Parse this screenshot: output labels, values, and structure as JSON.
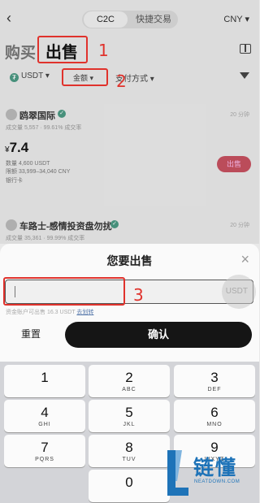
{
  "header": {
    "back_glyph": "‹",
    "tabs": [
      {
        "label": "C2C",
        "active": true
      },
      {
        "label": "快捷交易",
        "active": false
      }
    ],
    "currency": "CNY ▾"
  },
  "modes": {
    "buy": "购买",
    "sell": "出售",
    "sell_active": true
  },
  "filters": {
    "coin": "USDT ▾",
    "amount": "金额 ▾",
    "payment": "支付方式 ▾"
  },
  "annotations": [
    "1",
    "2",
    "3"
  ],
  "merchants": [
    {
      "name": "鸥翠国际",
      "stats": "成交量 5,557 · 99.61% 成交率",
      "response_time": "20 分钟",
      "price": "7.4",
      "currency_symbol": "¥",
      "quantity": "数量 4,600 USDT",
      "limit": "限额 33,999–34,040 CNY",
      "payment": "银行卡",
      "action": "出售"
    },
    {
      "name": "车路士-感情投资盘勿扰",
      "stats": "成交量 35,361 · 99.99% 成交率",
      "response_time": "20 分钟"
    }
  ],
  "sheet": {
    "title": "您要出售",
    "close_glyph": "×",
    "input_value": "",
    "unit": "USDT",
    "available_text": "资金账户可出售 16.3 USDT",
    "transfer_link": "去划转",
    "reset_label": "重置",
    "confirm_label": "确认"
  },
  "keypad": [
    {
      "digit": "1",
      "letters": ""
    },
    {
      "digit": "2",
      "letters": "ABC"
    },
    {
      "digit": "3",
      "letters": "DEF"
    },
    {
      "digit": "4",
      "letters": "GHI"
    },
    {
      "digit": "5",
      "letters": "JKL"
    },
    {
      "digit": "6",
      "letters": "MNO"
    },
    {
      "digit": "7",
      "letters": "PQRS"
    },
    {
      "digit": "8",
      "letters": "TUV"
    },
    {
      "digit": "9",
      "letters": "WXYZ"
    },
    {
      "digit": "0",
      "letters": ""
    }
  ],
  "watermark": {
    "title": "链懂",
    "subtitle": "NEATDOWN.COM"
  },
  "colors": {
    "annotation": "#e0322c",
    "accent_green": "#4a9a83",
    "sell_button": "#c8505f",
    "confirm_button": "#151515",
    "watermark": "#1e73b8"
  }
}
